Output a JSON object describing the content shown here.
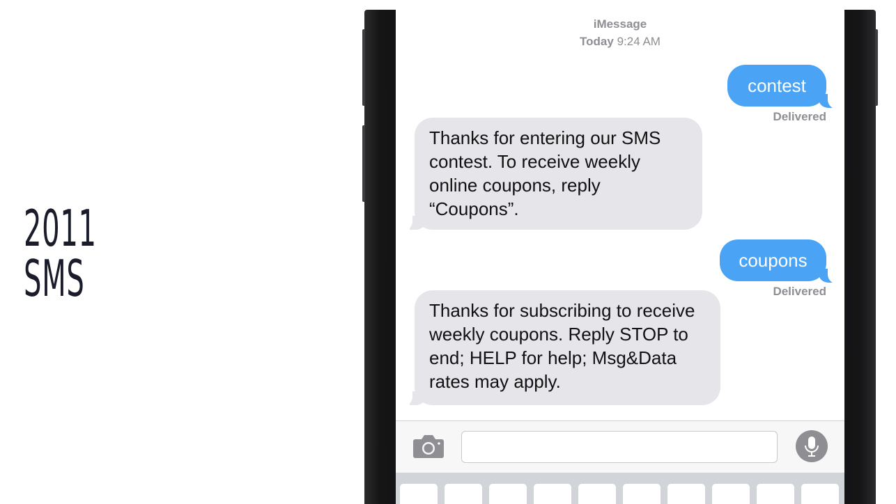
{
  "slide": {
    "title_line1": "2011",
    "title_line2": "SMS"
  },
  "conversation": {
    "service": "iMessage",
    "date_label": "Today",
    "time": "9:24 AM",
    "messages": [
      {
        "direction": "outgoing",
        "text": "contest",
        "status": "Delivered"
      },
      {
        "direction": "incoming",
        "text": "Thanks for entering our SMS contest. To receive weekly online coupons, reply “Coupons”."
      },
      {
        "direction": "outgoing",
        "text": "coupons",
        "status": "Delivered"
      },
      {
        "direction": "incoming",
        "text": "Thanks for subscribing to receive weekly coupons. Reply STOP to end; HELP for help; Msg&Data rates may apply."
      }
    ]
  },
  "input_bar": {
    "camera_icon": "camera-icon",
    "text_value": "",
    "mic_icon": "microphone-icon"
  },
  "colors": {
    "outgoing_bubble": "#4aa3f5",
    "incoming_bubble": "#e5e5ea",
    "title_text": "#1a1c2b"
  }
}
